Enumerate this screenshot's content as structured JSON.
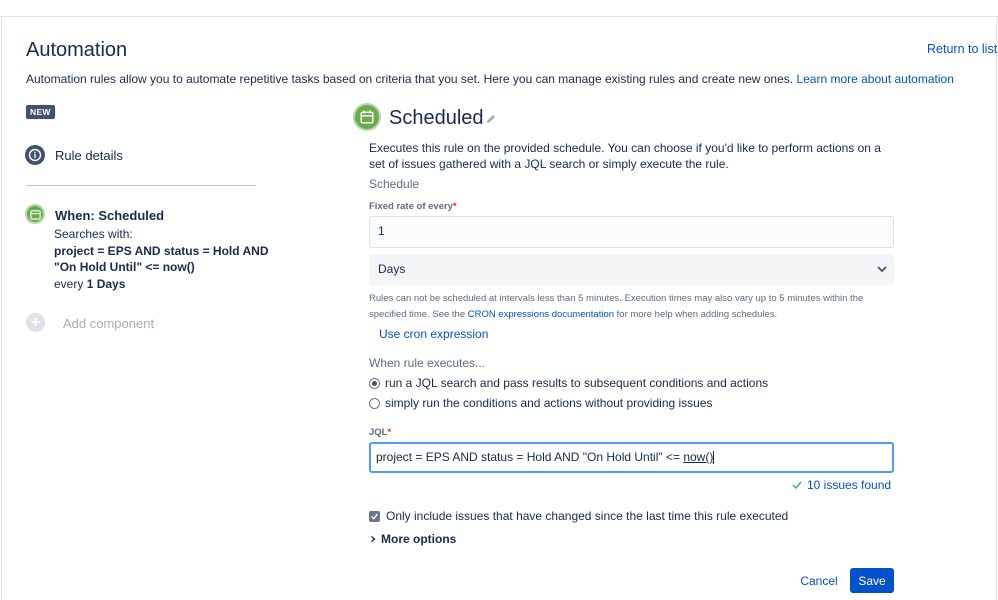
{
  "header": {
    "title": "Automation",
    "return_link": "Return to list",
    "description": "Automation rules allow you to automate repetitive tasks based on criteria that you set. Here you can manage existing rules and create new ones.",
    "learn_more": "Learn more about automation"
  },
  "sidebar": {
    "badge": "NEW",
    "rule_details": "Rule details",
    "trigger": {
      "title": "When: Scheduled",
      "searches_with": "Searches with:",
      "query": "project = EPS AND status = Hold AND \"On Hold Until\" <= now()",
      "every_prefix": "every",
      "every_value": "1 Days"
    },
    "add_component": "Add component"
  },
  "main": {
    "title": "Scheduled",
    "description": "Executes this rule on the provided schedule. You can choose if you'd like to perform actions on a set of issues gathered with a JQL search or simply execute the rule.",
    "schedule_label": "Schedule",
    "fixed_rate_label": "Fixed rate of every",
    "fixed_rate_value": "1",
    "unit_selected": "Days",
    "help_text_1": "Rules can not be scheduled at intervals less than 5 minutes. Execution times may also vary up to 5 minutes within the specified time. See the",
    "help_link": "CRON expressions documentation",
    "help_text_2": "for more help when adding schedules.",
    "cron_link": "Use cron expression",
    "when_executes_label": "When rule executes...",
    "radio_jql": "run a JQL search and pass results to subsequent conditions and actions",
    "radio_simple": "simply run the conditions and actions without providing issues",
    "jql_label": "JQL",
    "jql_prefix": "project = EPS AND status = Hold AND \"On Hold Until\" <= ",
    "jql_func": "now()",
    "issues_found": "10 issues found",
    "only_changed": "Only include issues that have changed since the last time this rule executed",
    "more_options": "More options",
    "cancel": "Cancel",
    "save": "Save"
  },
  "colors": {
    "accent": "#0052cc",
    "trigger_green": "#6aab4f",
    "focus_border": "#4c9aff"
  }
}
